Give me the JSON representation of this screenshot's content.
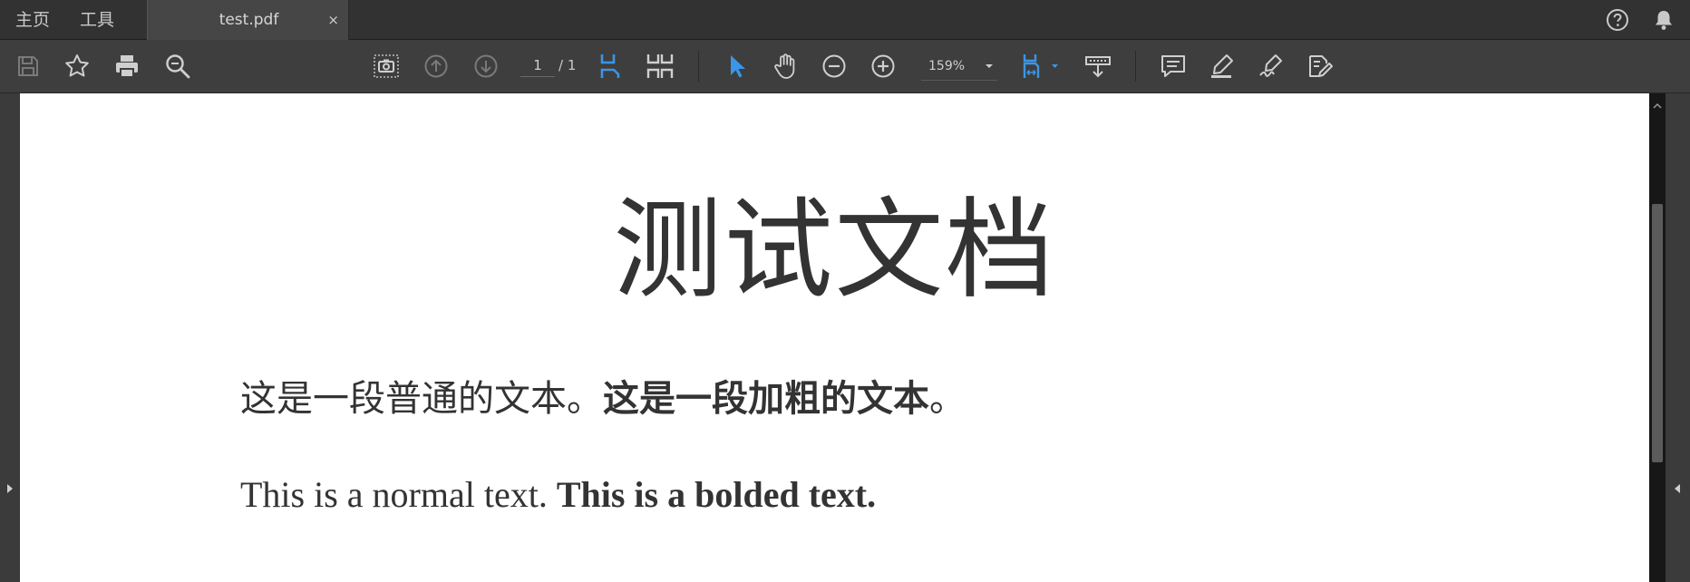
{
  "tabbar": {
    "home_label": "主页",
    "tools_label": "工具",
    "doc_tab_title": "test.pdf",
    "close_glyph": "×",
    "help_icon": "help-circle-icon",
    "bell_icon": "bell-icon"
  },
  "toolbar": {
    "page_current": "1",
    "page_total": "/ 1",
    "zoom_value": "159%",
    "icons": [
      "save-icon",
      "bookmark-star-icon",
      "print-icon",
      "search-zoom-icon",
      "snapshot-icon",
      "prev-page-icon",
      "next-page-icon",
      "single-page-icon",
      "two-page-icon",
      "select-cursor-icon",
      "hand-icon",
      "zoom-out-icon",
      "zoom-in-icon",
      "fit-page-icon",
      "scroll-mode-icon",
      "comment-icon",
      "highlight-icon",
      "sign-icon",
      "edit-pdf-icon"
    ],
    "accent_color": "#3a96e8"
  },
  "document": {
    "title": "测试文档",
    "zh_normal": "这是一段普通的文本。",
    "zh_bold": "这是一段加粗的文本",
    "zh_end": "。",
    "en_normal": "This is a normal text. ",
    "en_bold": "This is a bolded text."
  }
}
